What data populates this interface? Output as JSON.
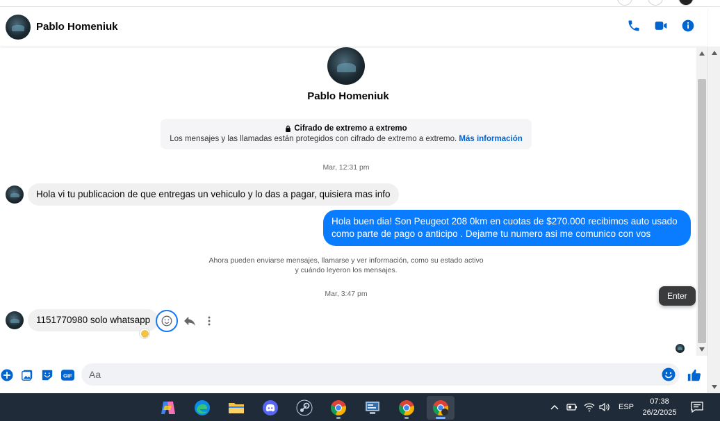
{
  "header": {
    "contact_name": "Pablo Homeniuk",
    "icons": [
      "phone-icon",
      "video-call-icon",
      "info-icon"
    ]
  },
  "profile": {
    "name": "Pablo Homeniuk"
  },
  "encryption": {
    "title": "Cifrado de extremo a extremo",
    "text": "Los mensajes y las llamadas están protegidos con cifrado de extremo a extremo.",
    "link": "Más información"
  },
  "conversation": {
    "timestamp_1": "Mar, 12:31 pm",
    "incoming_1": "Hola vi tu publicacion de que entregas un vehiculo y lo das a pagar, quisiera mas info",
    "outgoing_1": "Hola buen dia! Son Peugeot 208 0km en cuotas de $270.000 recibimos auto usado como parte de pago o anticipo . Dejame tu numero asi me comunico con vos",
    "system_line_1": "Ahora pueden enviarse mensajes, llamarse y ver información, como su estado activo",
    "system_line_2": "y cuándo leyeron los mensajes.",
    "timestamp_2": "Mar, 3:47 pm",
    "incoming_2": "1151770980 solo whatsapp"
  },
  "tooltip": {
    "label": "Enter"
  },
  "composer": {
    "placeholder": "Aa"
  },
  "taskbar": {
    "apps": [
      "copilot-icon",
      "edge-icon",
      "file-explorer-icon",
      "discord-icon",
      "steam-icon",
      "chrome-icon",
      "control-panel-icon",
      "chrome-icon",
      "chrome-icon"
    ],
    "language": "ESP",
    "time": "07:38",
    "date": "26/2/2025"
  },
  "colors": {
    "accent": "#0a7cff",
    "icon_blue": "#0064d1",
    "taskbar": "#1f2b38"
  }
}
